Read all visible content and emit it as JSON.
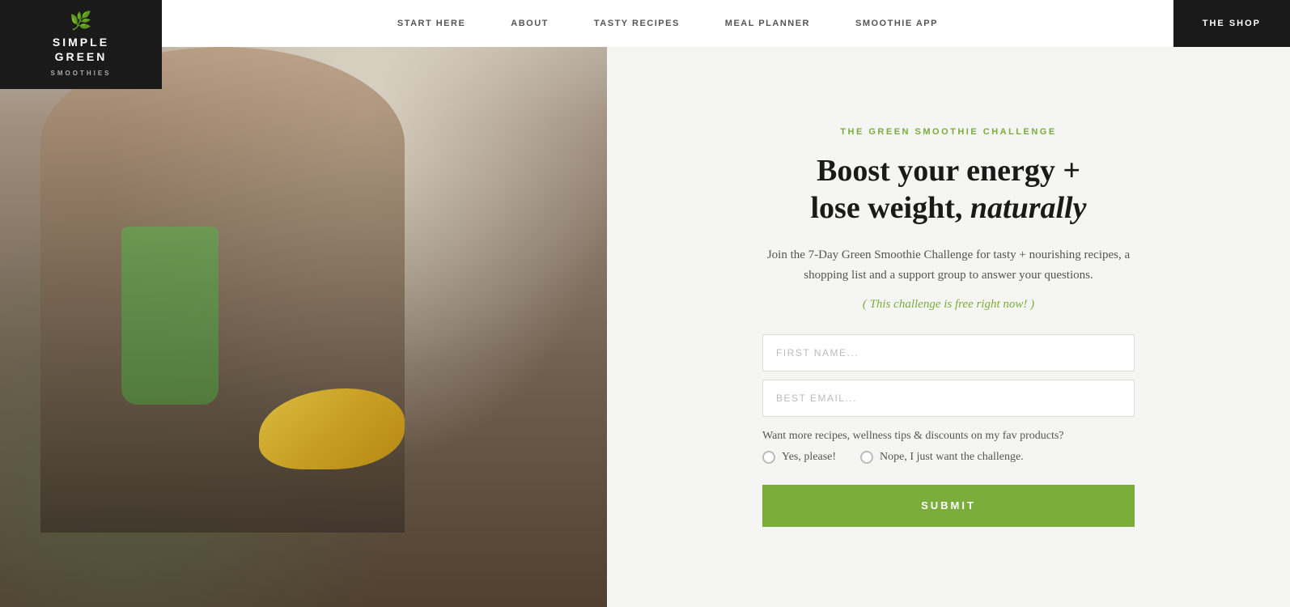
{
  "header": {
    "logo": {
      "leaves": "🌿",
      "line1": "SIMPLE",
      "line2": "GREEN",
      "line3": "SMOOTHIES"
    },
    "nav": {
      "items": [
        {
          "label": "START HERE",
          "id": "start-here"
        },
        {
          "label": "ABOUT",
          "id": "about"
        },
        {
          "label": "TASTY RECIPES",
          "id": "tasty-recipes"
        },
        {
          "label": "MEAL PLANNER",
          "id": "meal-planner"
        },
        {
          "label": "SMOOTHIE APP",
          "id": "smoothie-app"
        }
      ],
      "shop": {
        "label": "THE SHOP"
      }
    }
  },
  "hero": {
    "image_alt": "Woman pouring green smoothie in kitchen"
  },
  "form_panel": {
    "challenge_label": "THE GREEN SMOOTHIE CHALLENGE",
    "headline_part1": "Boost your energy +",
    "headline_part2": "lose weight, ",
    "headline_italic": "naturally",
    "description": "Join the 7-Day Green Smoothie Challenge for tasty + nourishing recipes, a shopping list and a support group to answer your questions.",
    "free_note": "( This challenge is free right now! )",
    "first_name_placeholder": "FIRST NAME...",
    "email_placeholder": "BEST EMAIL...",
    "radio_question": "Want more recipes, wellness tips & discounts on my fav products?",
    "radio_yes": "Yes, please!",
    "radio_no": "Nope, I just want the challenge.",
    "submit_label": "SUBMIT"
  }
}
